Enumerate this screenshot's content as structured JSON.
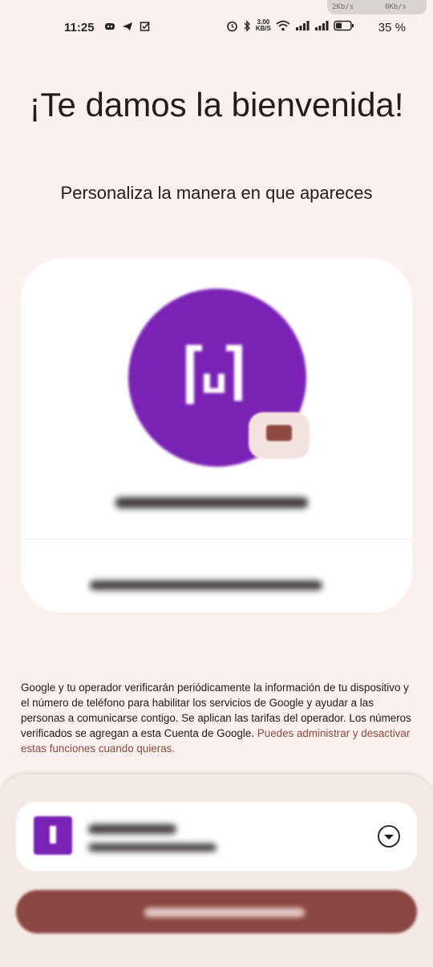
{
  "status_bar": {
    "time": "11:25",
    "upload_speed": "2Kb/s",
    "download_speed": "0Kb/s",
    "net_speed_value": "3.00",
    "net_speed_unit": "KB/S",
    "battery": "35 %",
    "icons_left": [
      "discord-icon",
      "telegram-icon",
      "check-box-icon"
    ],
    "icons_right": [
      "alarm-icon",
      "bluetooth-icon",
      "wifi-icon",
      "signal-icon",
      "signal-icon",
      "battery-icon"
    ]
  },
  "welcome": {
    "title": "¡Te damos la bienvenida!",
    "subtitle": "Personaliza la manera en que apareces"
  },
  "profile_card": {
    "avatar_color": "#7a22b5",
    "name_redacted": true,
    "phone_redacted": true
  },
  "disclaimer": {
    "text": "Google y tu operador verificarán periódicamente la información de tu dispositivo y el número de teléfono para habilitar los servicios de Google y ayudar a las personas a comunicarse contigo. Se aplican las tarifas del operador. Los números verificados se agregan a esta Cuenta de Google.",
    "link": "Puedes administrar y desactivar estas funciones cuando quieras."
  },
  "account_selector": {
    "name_redacted": true,
    "email_redacted": true,
    "icon": "chevron-down-icon"
  },
  "primary_button": {
    "label_redacted": true,
    "color": "#8a4640"
  }
}
